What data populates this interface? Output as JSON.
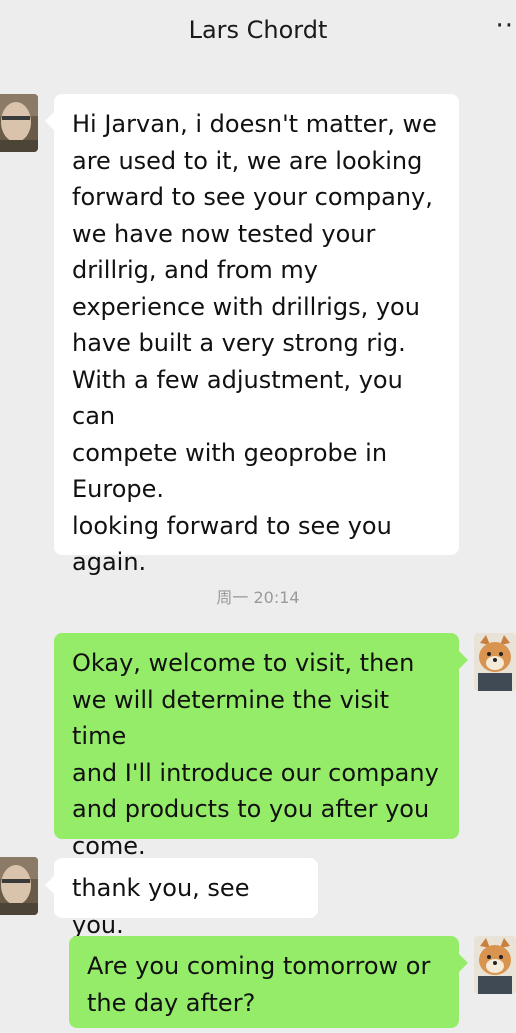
{
  "header": {
    "title": "Lars Chordt",
    "more_icon": "more-dots-icon"
  },
  "messages": [
    {
      "side": "left",
      "text": "Hi Jarvan, i doesn't matter, we\nare used to it, we are looking\nforward to see your company,\nwe have now tested your\ndrillrig, and from my\nexperience with drillrigs, you\nhave built a very strong rig.\nWith a few adjustment, you can\ncompete with geoprobe in\nEurope.\nlooking forward to see you\nagain."
    },
    {
      "side": "right",
      "text": "Okay, welcome to visit, then\nwe will determine the visit time\nand I'll introduce our company\nand products to you after you\ncome."
    },
    {
      "side": "left",
      "text": "thank you, see you."
    },
    {
      "side": "right",
      "text": "Are you coming tomorrow or\nthe day after?"
    }
  ],
  "timestamp": "周一 20:14",
  "colors": {
    "background": "#ededed",
    "incoming_bubble": "#ffffff",
    "outgoing_bubble": "#95ec69"
  }
}
